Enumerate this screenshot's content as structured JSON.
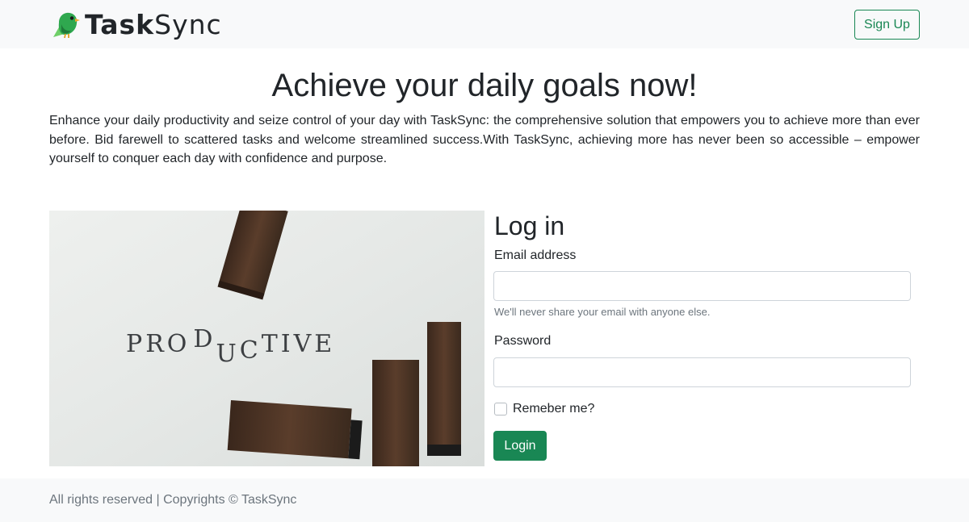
{
  "brand": {
    "name_bold": "Task",
    "name_light": "Sync"
  },
  "nav": {
    "signup_label": "Sign Up"
  },
  "hero": {
    "headline": "Achieve your daily goals now!",
    "intro": "Enhance your daily productivity and seize control of your day with TaskSync: the comprehensive solution that empowers you to achieve more than ever before. Bid farewell to scattered tasks and welcome streamlined success.With TaskSync, achieving more has never been so accessible – empower yourself to conquer each day with confidence and purpose.",
    "image_word": "PRODUCTIVE"
  },
  "login": {
    "title": "Log in",
    "email_label": "Email address",
    "email_value": "",
    "email_help": "We'll never share your email with anyone else.",
    "password_label": "Password",
    "password_value": "",
    "remember_label": "Remeber me?",
    "remember_checked": false,
    "submit_label": "Login"
  },
  "footer": {
    "text": "All rights reserved | Copyrights © TaskSync"
  },
  "colors": {
    "accent": "#198754",
    "nav_bg": "#f8f9fa",
    "muted": "#6c757d"
  },
  "icons": {
    "logo": "bird-icon"
  }
}
